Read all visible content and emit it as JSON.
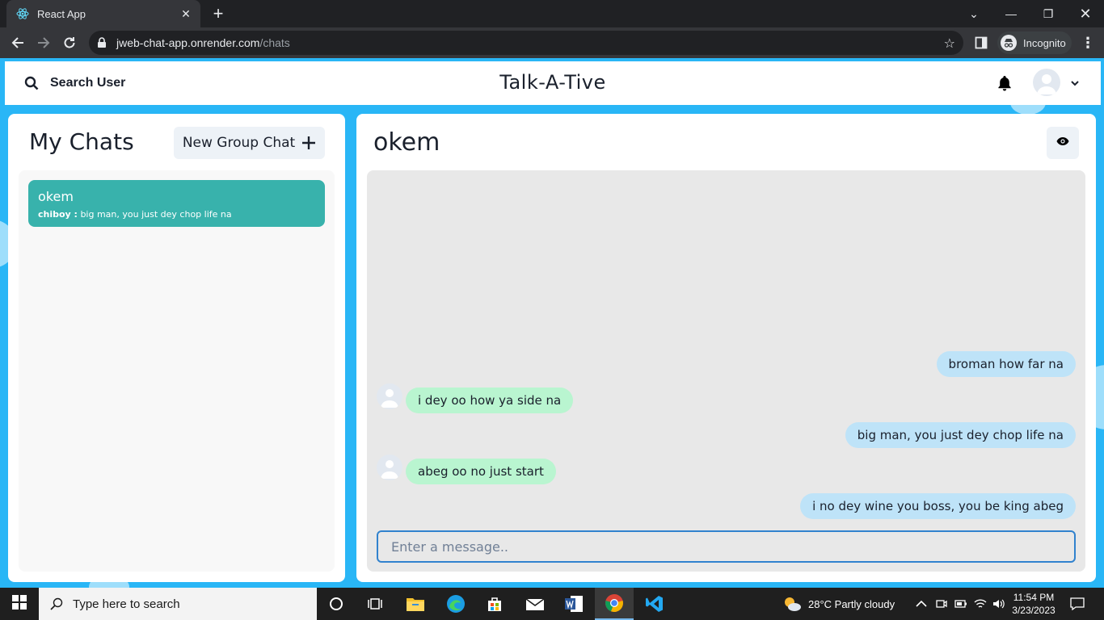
{
  "browser": {
    "tab_title": "React App",
    "url_host": "jweb-chat-app.onrender.com",
    "url_path": "/chats",
    "incognito_label": "Incognito"
  },
  "header": {
    "search_label": "Search User",
    "app_title": "Talk-A-Tive"
  },
  "my_chats": {
    "title": "My Chats",
    "new_group_label": "New Group Chat",
    "chats": [
      {
        "name": "okem",
        "latest_sender": "chiboy :",
        "latest_text": " big man, you just dey chop life na",
        "selected": true
      }
    ]
  },
  "chat": {
    "name": "okem",
    "messages": [
      {
        "text": "broman how far na",
        "mine": true
      },
      {
        "text": "i dey oo how ya side na",
        "mine": false
      },
      {
        "text": "big man, you just dey chop life na",
        "mine": true
      },
      {
        "text": "abeg oo no just start",
        "mine": false
      },
      {
        "text": "i no dey wine you boss, you be king abeg",
        "mine": true
      }
    ],
    "input_placeholder": "Enter a message..",
    "input_value": ""
  },
  "taskbar": {
    "search_placeholder": "Type here to search",
    "weather": "28°C  Partly cloudy",
    "time": "11:54 PM",
    "date": "3/23/2023"
  },
  "colors": {
    "selected_chat": "#38b2ac",
    "my_message": "#bee3f8",
    "their_message": "#b9f5d0",
    "page_background": "#29b6f6"
  }
}
